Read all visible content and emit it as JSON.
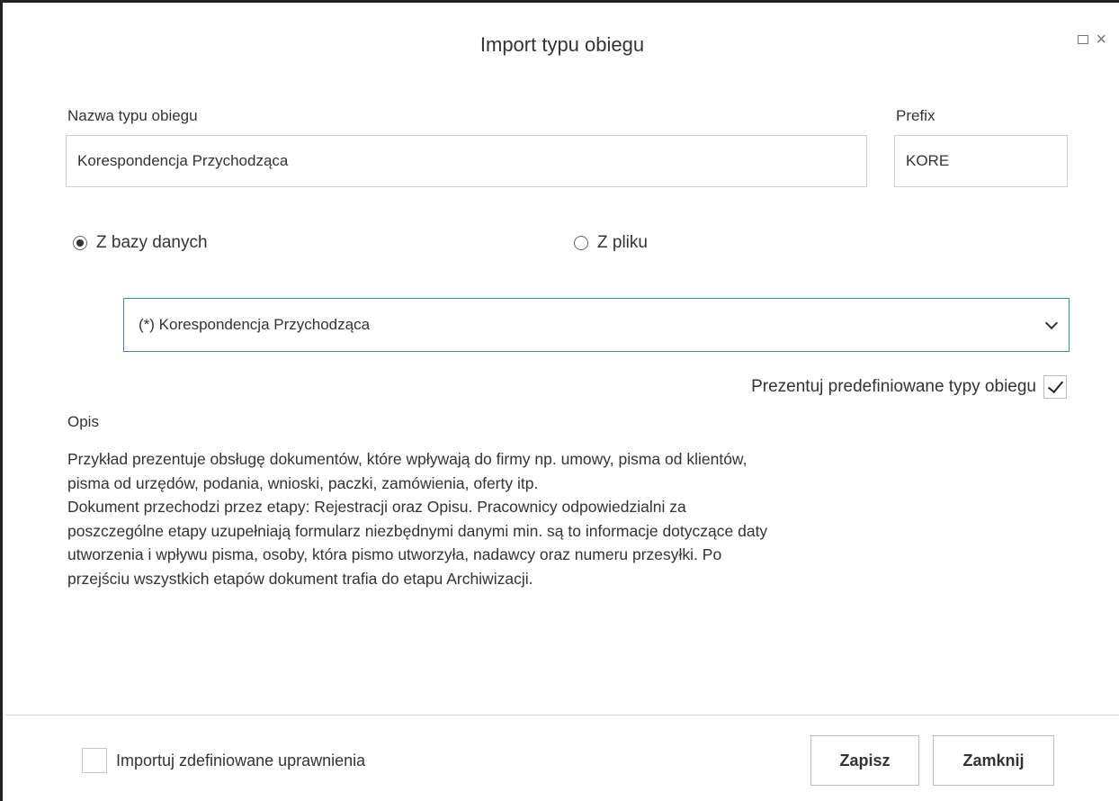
{
  "dialog": {
    "title": "Import typu obiegu",
    "controls": {
      "maximize_icon": "maximize-icon",
      "close_icon": "close-icon"
    }
  },
  "form": {
    "name_label": "Nazwa typu obiegu",
    "name_value": "Korespondencja Przychodząca",
    "prefix_label": "Prefix",
    "prefix_value": "KORE",
    "source_options": [
      {
        "label": "Z bazy danych",
        "selected": true
      },
      {
        "label": "Z pliku",
        "selected": false
      }
    ],
    "template_select": {
      "selected_value": "(*) Korespondencja Przychodząca"
    },
    "predefined_label": "Prezentuj predefiniowane typy obiegu",
    "predefined_checked": true,
    "description_label": "Opis",
    "description_text": "Przykład prezentuje obsługę dokumentów, które wpływają do firmy np. umowy, pisma od klientów,\npisma od urzędów, podania, wnioski, paczki, zamówienia, oferty itp.\nDokument przechodzi przez etapy: Rejestracji oraz Opisu. Pracownicy odpowiedzialni za\nposzczególne etapy uzupełniają formularz niezbędnymi danymi min. są to informacje dotyczące daty\nutworzenia i wpływu pisma, osoby, która pismo utworzyła,  nadawcy oraz numeru przesyłki. Po\nprzejściu wszystkich etapów dokument trafia do etapu Archiwizacji."
  },
  "footer": {
    "import_permissions_label": "Importuj zdefiniowane uprawnienia",
    "import_permissions_checked": false,
    "save_label": "Zapisz",
    "close_label": "Zamknij"
  }
}
